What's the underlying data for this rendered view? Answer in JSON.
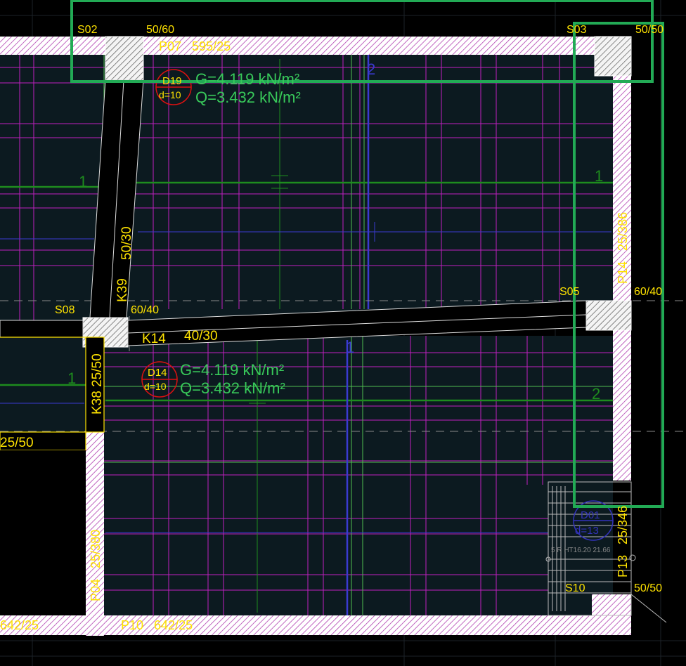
{
  "colors": {
    "background": "#000000",
    "slab_fill": "#0c1a20",
    "wall_hatch": "#ffffff",
    "wall_hatch_line": "#ff00ff",
    "rebar_grid": "#cc22cc",
    "beam_fill": "#000000",
    "label_yellow": "#ffe300",
    "load_green": "#38c95a",
    "span_green": "#1f8a1f",
    "dim_blue": "#3333cc",
    "slab_red": "#dd1111",
    "selection_green": "#22aa55",
    "dash_grey": "#777777"
  },
  "columns": {
    "s02": {
      "name": "S02",
      "size": "50/60"
    },
    "s03": {
      "name": "S03",
      "size": "50/50"
    },
    "s05": {
      "name": "S05",
      "size": "60/40"
    },
    "s08": {
      "name": "S08",
      "size": "60/40"
    },
    "s10": {
      "name": "S10",
      "size": "50/50"
    }
  },
  "walls": {
    "top": "P07   595/25",
    "right": "P14   25/386",
    "right_lower": "P13   25/346",
    "left": "P04   25/380",
    "bottom": "P10   642/25",
    "bottom_left": "642/25"
  },
  "beams": {
    "k39": {
      "name": "K39",
      "size": "50/30"
    },
    "k14": {
      "name": "K14",
      "size": "40/30"
    },
    "k38": {
      "name": "K38 25/50"
    },
    "left": {
      "size": "25/50"
    }
  },
  "slabs": {
    "d19": {
      "name": "D19",
      "thickness": "d=10",
      "g": "G=4.119 kN/m²",
      "q": "Q=3.432 kN/m²"
    },
    "d14": {
      "name": "D14",
      "thickness": "d=10",
      "g": "G=4.119 kN/m²",
      "q": "Q=3.432 kN/m²"
    },
    "stair": {
      "name": "D01",
      "thickness": "d=13"
    }
  },
  "span_marks": {
    "upper_left": "1",
    "upper_right": "1",
    "lower_left": "1",
    "lower_right": "2",
    "dim_top": "2",
    "dim_mid": "1"
  },
  "stair_text": "5 R HT16.20 21.66"
}
